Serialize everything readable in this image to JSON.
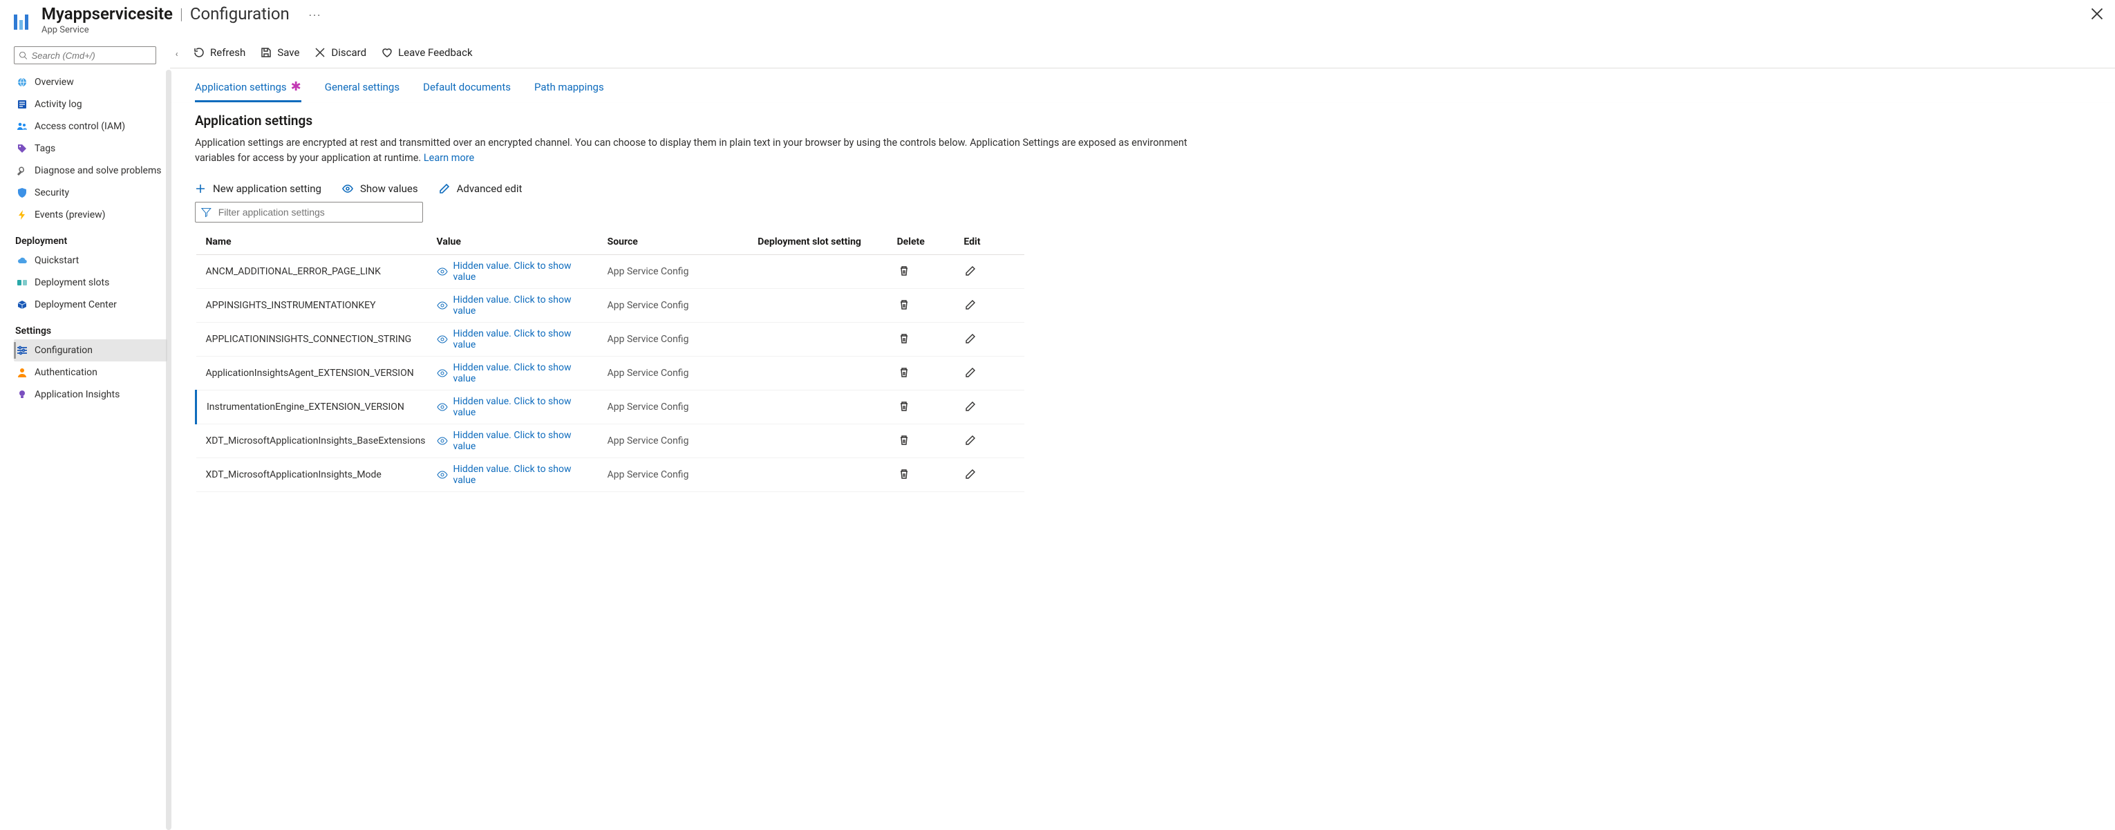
{
  "header": {
    "title_main": "Myappservicesite",
    "title_separator": "|",
    "title_page": "Configuration",
    "subtitle": "App Service",
    "more_label": "···"
  },
  "nav": {
    "search_placeholder": "Search (Cmd+/)",
    "items_top": [
      {
        "icon": "globe",
        "label": "Overview",
        "color": "c-blue"
      },
      {
        "icon": "log",
        "label": "Activity log",
        "color": "c-dblue"
      },
      {
        "icon": "people",
        "label": "Access control (IAM)",
        "color": "c-blue"
      },
      {
        "icon": "tag",
        "label": "Tags",
        "color": "c-purple"
      },
      {
        "icon": "wrench",
        "label": "Diagnose and solve problems",
        "color": "c-gray"
      },
      {
        "icon": "shield",
        "label": "Security",
        "color": "c-blue"
      },
      {
        "icon": "bolt",
        "label": "Events (preview)",
        "color": "c-yellow"
      }
    ],
    "section_deploy": "Deployment",
    "items_deploy": [
      {
        "icon": "cloud",
        "label": "Quickstart",
        "color": "c-blue"
      },
      {
        "icon": "slots",
        "label": "Deployment slots",
        "color": "c-teal"
      },
      {
        "icon": "box",
        "label": "Deployment Center",
        "color": "c-dblue"
      }
    ],
    "section_settings": "Settings",
    "items_settings": [
      {
        "icon": "sliders",
        "label": "Configuration",
        "color": "c-dblue",
        "selected": true
      },
      {
        "icon": "person",
        "label": "Authentication",
        "color": "c-orange"
      },
      {
        "icon": "bulb",
        "label": "Application Insights",
        "color": "c-purple"
      }
    ]
  },
  "cmdbar": {
    "refresh": "Refresh",
    "save": "Save",
    "discard": "Discard",
    "feedback": "Leave Feedback"
  },
  "tabs": [
    {
      "label": "Application settings",
      "active": true,
      "dirty": true
    },
    {
      "label": "General settings",
      "active": false
    },
    {
      "label": "Default documents",
      "active": false
    },
    {
      "label": "Path mappings",
      "active": false
    }
  ],
  "section": {
    "heading": "Application settings",
    "body": "Application settings are encrypted at rest and transmitted over an encrypted channel. You can choose to display them in plain text in your browser by using the controls below. Application Settings are exposed as environment variables for access by your application at runtime.",
    "learn_more": "Learn more"
  },
  "settings_toolbar": {
    "new_setting": "New application setting",
    "show_values": "Show values",
    "advanced_edit": "Advanced edit"
  },
  "filter_placeholder": "Filter application settings",
  "table": {
    "headers": {
      "name": "Name",
      "value": "Value",
      "source": "Source",
      "slot": "Deployment slot setting",
      "delete": "Delete",
      "edit": "Edit"
    },
    "hidden_value_text": "Hidden value. Click to show value",
    "source_text": "App Service Config",
    "rows": [
      {
        "name": "ANCM_ADDITIONAL_ERROR_PAGE_LINK"
      },
      {
        "name": "APPINSIGHTS_INSTRUMENTATIONKEY"
      },
      {
        "name": "APPLICATIONINSIGHTS_CONNECTION_STRING"
      },
      {
        "name": "ApplicationInsightsAgent_EXTENSION_VERSION"
      },
      {
        "name": "InstrumentationEngine_EXTENSION_VERSION",
        "selected": true
      },
      {
        "name": "XDT_MicrosoftApplicationInsights_BaseExtensions"
      },
      {
        "name": "XDT_MicrosoftApplicationInsights_Mode"
      }
    ]
  }
}
